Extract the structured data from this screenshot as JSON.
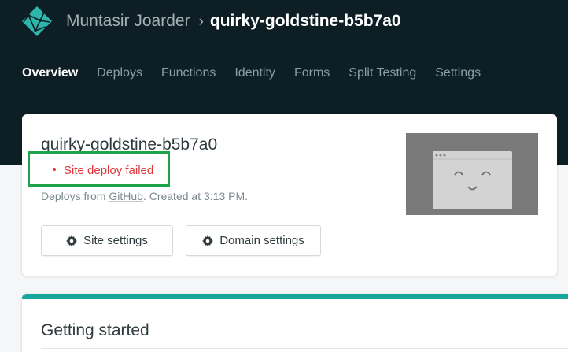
{
  "header": {
    "team_name": "Muntasir Joarder",
    "separator": "›",
    "site_name": "quirky-goldstine-b5b7a0",
    "logo_icon": "netlify-logo-icon"
  },
  "nav": {
    "items": [
      {
        "label": "Overview",
        "active": true
      },
      {
        "label": "Deploys"
      },
      {
        "label": "Functions"
      },
      {
        "label": "Identity"
      },
      {
        "label": "Forms"
      },
      {
        "label": "Split Testing"
      },
      {
        "label": "Settings"
      }
    ]
  },
  "site_card": {
    "name": "quirky-goldstine-b5b7a0",
    "status": "Site deploy failed",
    "status_color": "#e0383a",
    "meta_prefix": "Deploys from ",
    "meta_repo": "GitHub",
    "meta_suffix": ". Created at 3:13 PM.",
    "site_settings_label": "Site settings",
    "domain_settings_label": "Domain settings"
  },
  "getting_started": {
    "title": "Getting started"
  },
  "colors": {
    "header_bg": "#0e1e25",
    "accent": "#16a79a",
    "highlight_box": "#1ea24a"
  }
}
